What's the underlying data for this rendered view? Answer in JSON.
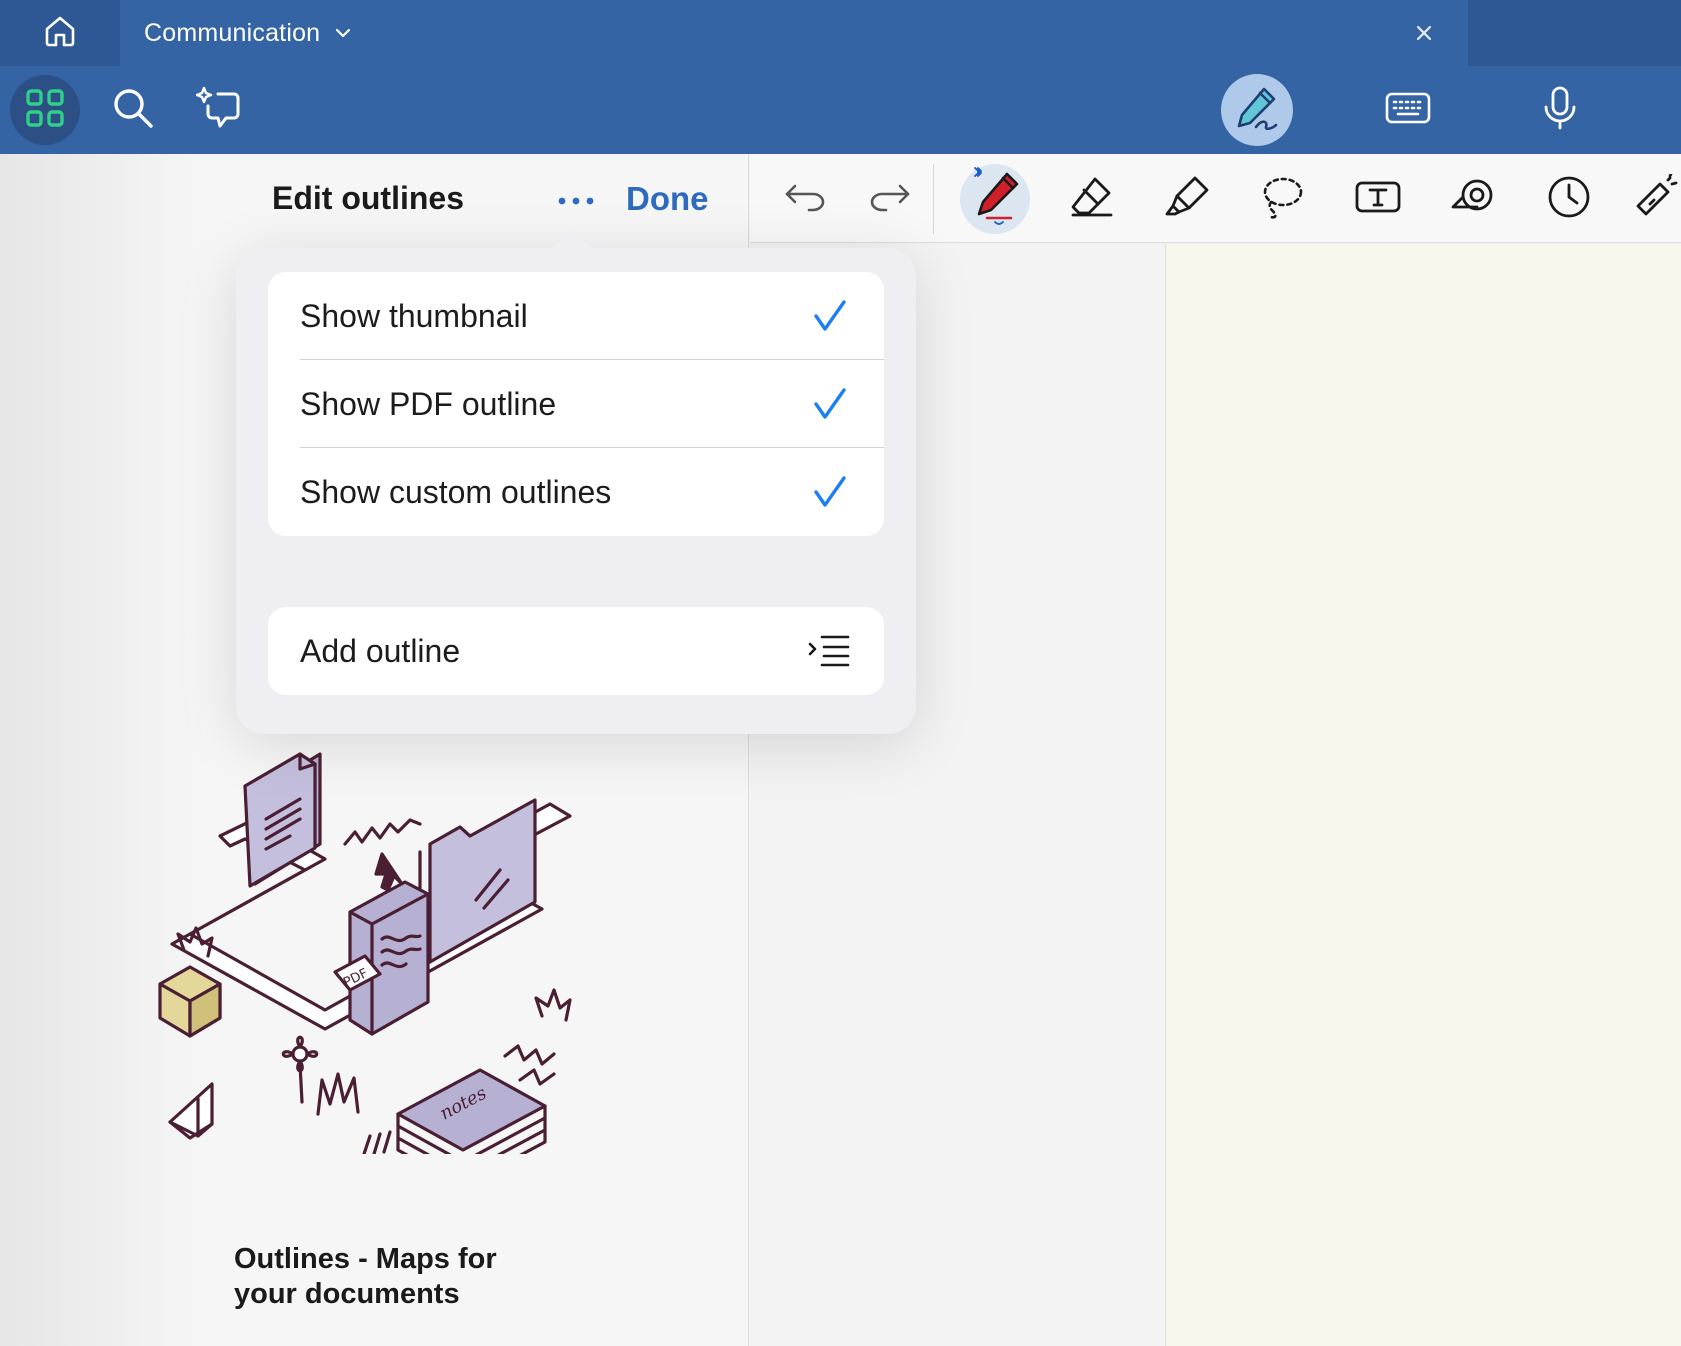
{
  "tab": {
    "title": "Communication"
  },
  "panel": {
    "title": "Edit outlines",
    "done_label": "Done",
    "caption": "Outlines - Maps for your documents"
  },
  "popover": {
    "options": [
      {
        "label": "Show thumbnail",
        "checked": true
      },
      {
        "label": "Show PDF outline",
        "checked": true
      },
      {
        "label": "Show custom outlines",
        "checked": true
      }
    ],
    "add_label": "Add outline"
  },
  "icons": {
    "tabbar": [
      "home-icon",
      "chevron-down-icon",
      "close-icon"
    ],
    "toolbar": [
      "grid-apps-icon",
      "search-icon",
      "ai-assist-icon",
      "pen-handwriting-icon",
      "keyboard-icon",
      "microphone-icon"
    ],
    "drawing": [
      "undo-icon",
      "redo-icon",
      "pen-icon",
      "eraser-icon",
      "highlighter-icon",
      "lasso-icon",
      "text-box-icon",
      "tape-icon",
      "clock-icon",
      "laser-pointer-icon"
    ]
  },
  "colors": {
    "header_blue": "#3564a4",
    "accent_blue": "#2e6bbd",
    "check_blue": "#1a7ff0",
    "pen_red": "#d0202a",
    "paper": "#f7f6ec",
    "apps_green": "#2fd08a"
  }
}
